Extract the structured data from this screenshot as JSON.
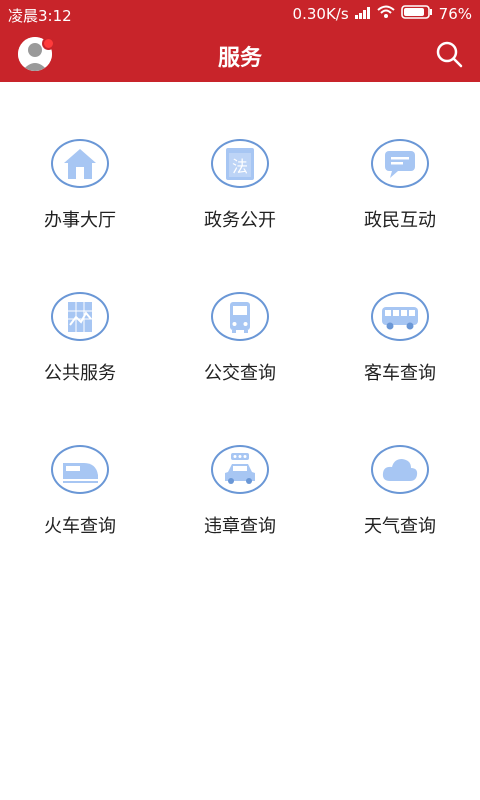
{
  "status": {
    "time": "凌晨3:12",
    "speed": "0.30K/s",
    "battery": "76%"
  },
  "header": {
    "title": "服务"
  },
  "services": [
    {
      "label": "办事大厅",
      "icon": "house-icon"
    },
    {
      "label": "政务公开",
      "icon": "law-book-icon"
    },
    {
      "label": "政民互动",
      "icon": "chat-bubble-icon"
    },
    {
      "label": "公共服务",
      "icon": "chart-board-icon"
    },
    {
      "label": "公交查询",
      "icon": "bus-icon"
    },
    {
      "label": "客车查询",
      "icon": "coach-icon"
    },
    {
      "label": "火车查询",
      "icon": "train-icon"
    },
    {
      "label": "违章查询",
      "icon": "car-icon"
    },
    {
      "label": "天气查询",
      "icon": "cloud-icon"
    }
  ],
  "icon_texts": {
    "law": "法"
  },
  "colors": {
    "brand": "#c8242a",
    "icon_border": "#6a97d6",
    "icon_fill": "#a7c6f3"
  }
}
